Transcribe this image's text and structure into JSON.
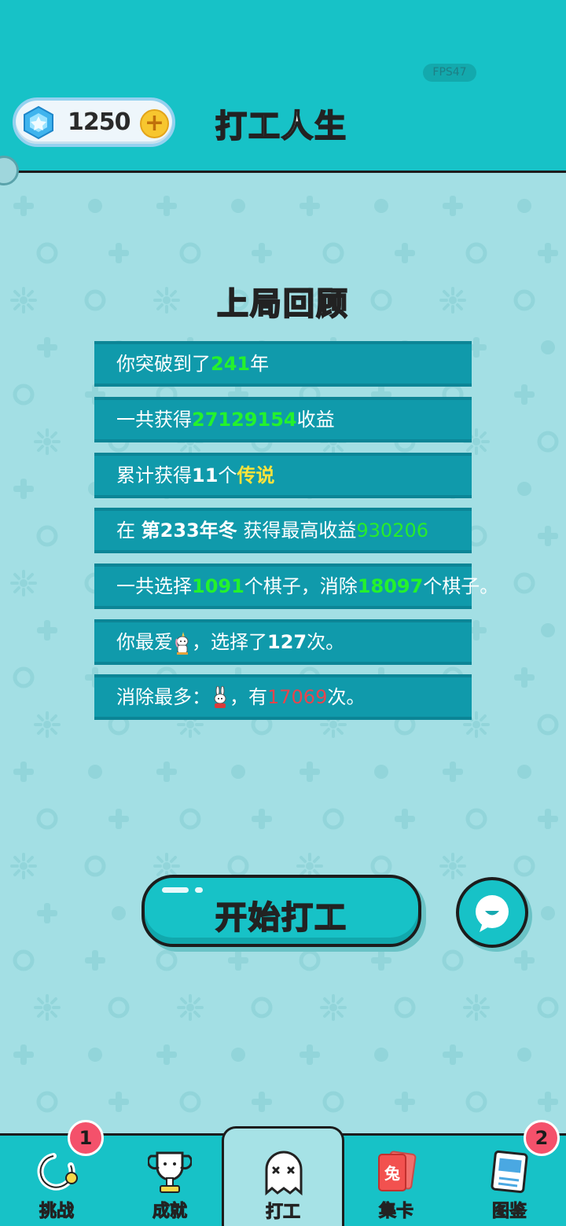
{
  "header": {
    "fps": "FPS47",
    "gems": "1250",
    "title": "打工人生"
  },
  "review": {
    "title": "上局回顾",
    "rows": [
      {
        "pre": "你突破到了",
        "val": "241",
        "post": "年"
      },
      {
        "pre": "一共获得",
        "val": "27129154",
        "post": "收益"
      },
      {
        "pre": "累计获得",
        "val": "11",
        "mid": "个",
        "val2": "传说"
      },
      {
        "pre": "在 ",
        "val": "第233年冬",
        "mid": " 获得最高收益",
        "val2": "930206"
      },
      {
        "pre": "一共选择",
        "val": "1091",
        "mid": "个棋子，消除",
        "val2": "18097",
        "post": "个棋子。"
      },
      {
        "pre": "你最爱",
        "mid": "，选择了",
        "val": "127",
        "post": "次。"
      },
      {
        "pre": "消除最多：",
        "mid": "，有",
        "val": "17069",
        "post": "次。"
      }
    ]
  },
  "start_button": "开始打工",
  "nav": [
    {
      "label": "挑战",
      "badge": "1",
      "icon": "challenge-icon"
    },
    {
      "label": "成就",
      "icon": "trophy-icon"
    },
    {
      "label": "打工",
      "icon": "ghost-icon",
      "active": true
    },
    {
      "label": "集卡",
      "icon": "card-icon",
      "card_text": "兔"
    },
    {
      "label": "图鉴",
      "badge": "2",
      "icon": "handbook-icon"
    }
  ],
  "colors": {
    "teal": "#17c2c7",
    "background": "#a3dfe4",
    "row": "#109aab",
    "highlight_green": "#24f22c",
    "highlight_yellow": "#ffe33b",
    "highlight_red": "#e8444c",
    "badge": "#f4516b"
  }
}
